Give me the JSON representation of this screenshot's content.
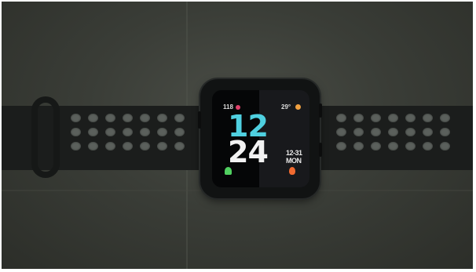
{
  "watch": {
    "time": {
      "hour": "12",
      "minute": "24"
    },
    "heart_rate": "118",
    "temperature": "29°",
    "date": "12-31 MON"
  },
  "colors": {
    "hour_accent": "#4fd0e0",
    "digit_text": "#f2f2f2",
    "heart": "#e0406a",
    "steps": "#50d060",
    "calories": "#f06a30",
    "weather": "#f0a040"
  },
  "icons": [
    "heart-icon",
    "sun-icon",
    "runner-icon",
    "flame-icon"
  ]
}
